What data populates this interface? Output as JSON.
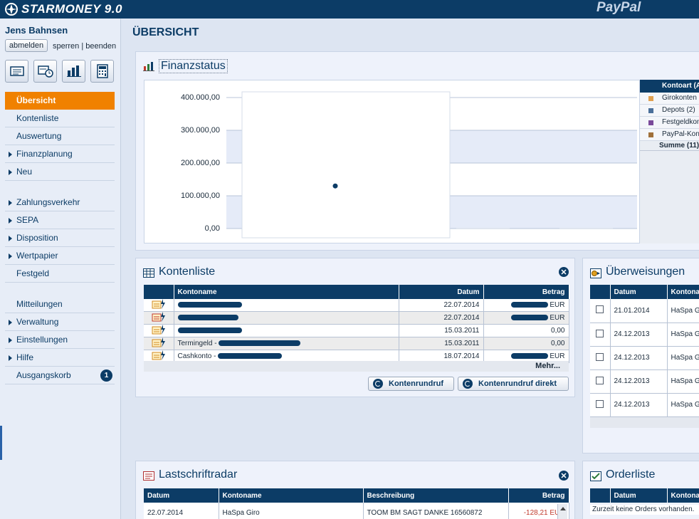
{
  "app": {
    "brand": "STARMONEY 9.0",
    "partner": "PayPal"
  },
  "user": {
    "name": "Jens Bahnsen",
    "logout_label": "abmelden",
    "lock_label": "sperren",
    "separator": "|",
    "quit_label": "beenden"
  },
  "quick_icons": [
    "accounts-card-icon",
    "transfer-clock-icon",
    "finance-bars-icon",
    "calculator-icon"
  ],
  "nav": [
    {
      "label": "Übersicht",
      "active": true,
      "arrow": false
    },
    {
      "label": "Kontenliste",
      "arrow": false
    },
    {
      "label": "Auswertung",
      "arrow": false
    },
    {
      "label": "Finanzplanung",
      "arrow": true
    },
    {
      "label": "Neu",
      "arrow": true
    },
    {
      "gap": true
    },
    {
      "label": "Zahlungsverkehr",
      "arrow": true
    },
    {
      "label": "SEPA",
      "arrow": true
    },
    {
      "label": "Disposition",
      "arrow": true
    },
    {
      "label": "Wertpapier",
      "arrow": true
    },
    {
      "label": "Festgeld",
      "arrow": false
    },
    {
      "gap": true
    },
    {
      "label": "Mitteilungen",
      "arrow": false
    },
    {
      "label": "Verwaltung",
      "arrow": true
    },
    {
      "label": "Einstellungen",
      "arrow": true
    },
    {
      "label": "Hilfe",
      "arrow": true
    },
    {
      "label": "Ausgangskorb",
      "arrow": false,
      "badge": "1"
    }
  ],
  "page": {
    "title": "ÜBERSICHT"
  },
  "finanzstatus": {
    "title": "Finanzstatus",
    "legend_header": "Kontoart (A",
    "legend": [
      {
        "label": "Girokonten",
        "color": "#e0a050"
      },
      {
        "label": "Depots (2)",
        "color": "#4a6f9a"
      },
      {
        "label": "Festgeldkon",
        "color": "#7a4a9a"
      },
      {
        "label": "PayPal-Kon",
        "color": "#a0703a"
      }
    ],
    "legend_sum": "Summe (11)"
  },
  "chart_data": {
    "type": "bar",
    "title": "Finanzstatus",
    "ylim": [
      0,
      400000
    ],
    "yticks": [
      "400.000,00",
      "300.000,00",
      "200.000,00",
      "100.000,00",
      "0,00"
    ],
    "ytick_values": [
      400000,
      300000,
      200000,
      100000,
      0
    ],
    "grid": true,
    "series": [
      {
        "name": "Girokonten",
        "point_value": 130000
      }
    ]
  },
  "kontenliste": {
    "title": "Kontenliste",
    "columns": [
      "Kontoname",
      "Datum",
      "Betrag"
    ],
    "rows": [
      {
        "icon": "account-card-icon",
        "name": "",
        "date": "22.07.2014",
        "amount": "EUR"
      },
      {
        "icon": "depot-chart-icon",
        "name": "",
        "date": "22.07.2014",
        "amount": "EUR"
      },
      {
        "icon": "account-card-icon",
        "name": "",
        "date": "15.03.2011",
        "amount": "0,00"
      },
      {
        "icon": "account-card-icon",
        "name": "Termingeld - ",
        "date": "15.03.2011",
        "amount": "0,00"
      },
      {
        "icon": "account-card-icon",
        "name": "Cashkonto - ",
        "date": "18.07.2014",
        "amount": "EUR"
      }
    ],
    "more_label": "Mehr...",
    "btn_refresh": "Kontenrundruf",
    "btn_refresh_direct": "Kontenrundruf direkt"
  },
  "ueberweisungen": {
    "title": "Überweisungen",
    "columns": [
      "",
      "Datum",
      "Kontonar"
    ],
    "rows": [
      {
        "date": "21.01.2014",
        "account": "HaSpa Gi"
      },
      {
        "date": "24.12.2013",
        "account": "HaSpa Gi"
      },
      {
        "date": "24.12.2013",
        "account": "HaSpa Gi"
      },
      {
        "date": "24.12.2013",
        "account": "HaSpa Gi"
      },
      {
        "date": "24.12.2013",
        "account": "HaSpa Gi"
      }
    ]
  },
  "lastschriftradar": {
    "title": "Lastschriftradar",
    "columns": [
      "Datum",
      "Kontoname",
      "Beschreibung",
      "Betrag"
    ],
    "rows": [
      {
        "date": "22.07.2014",
        "account": "HaSpa Giro",
        "desc": "TOOM BM SAGT DANKE 16560872",
        "amount": "-128,21 EUR"
      }
    ]
  },
  "orderliste": {
    "title": "Orderliste",
    "columns": [
      "",
      "Datum",
      "Kontonar"
    ],
    "empty": "Zurzeit keine Orders vorhanden."
  }
}
